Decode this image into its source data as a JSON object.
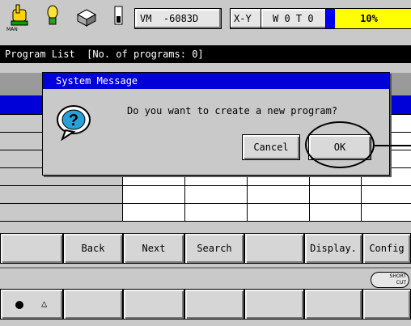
{
  "topbar": {
    "mode_label": "MAN",
    "machine": "VM  -6083D",
    "plane": "X-Y",
    "status_flags": "W 0 T 0",
    "progress_text": "10%",
    "progress_value": 0.1
  },
  "title": "Program List  [No. of programs: 0]",
  "dialog": {
    "title": "System Message",
    "message": "Do you want to create a new program?",
    "cancel": "Cancel",
    "ok": "OK"
  },
  "function_keys": [
    "",
    "Back",
    "Next",
    "Search",
    "",
    "Display.",
    "Config"
  ],
  "shortcut_label_top": "SHORT",
  "shortcut_label_bottom": "CUT",
  "colors": {
    "accent": "#0000d8",
    "progress": "#ffff00",
    "titlebar": "#000000"
  }
}
